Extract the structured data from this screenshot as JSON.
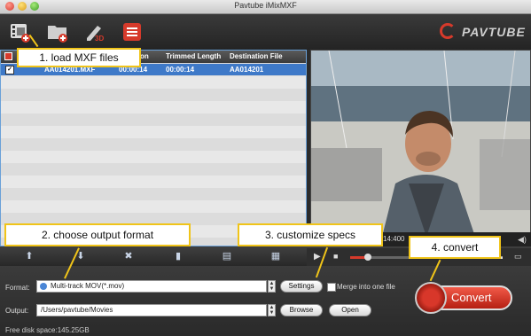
{
  "window": {
    "title": "Pavtube iMixMXF"
  },
  "brand": {
    "name": "PAVTUBE",
    "accent": "#d63a2b"
  },
  "toolbar": {
    "icons": [
      "add-video-icon",
      "add-folder-icon",
      "edit-3d-icon",
      "task-list-icon"
    ]
  },
  "file_list": {
    "columns": [
      "",
      "on",
      "Trimmed Length",
      "Destination File"
    ],
    "rows": [
      {
        "name": "AA014201.MXF",
        "duration": "00:00:14",
        "trimmed": "00:00:14",
        "destination": "AA014201"
      }
    ]
  },
  "preview": {
    "time": "14:400"
  },
  "list_controls": [
    "move-up-icon",
    "move-down-icon",
    "delete-icon",
    "trash-icon",
    "subtitle-icon",
    "merge-icon"
  ],
  "format": {
    "label": "Format:",
    "value": "Multi-track MOV(*.mov)",
    "settings_button": "Settings",
    "merge_label": "Merge into one file"
  },
  "output": {
    "label": "Output:",
    "value": "/Users/pavtube/Movies",
    "browse_button": "Browse",
    "open_button": "Open"
  },
  "status": {
    "free_space": "Free disk space:145.25GB"
  },
  "convert": {
    "label": "Convert"
  },
  "callouts": {
    "c1": "1. load MXF files",
    "c2": "2. choose output format",
    "c3": "3. customize specs",
    "c4": "4. convert"
  }
}
